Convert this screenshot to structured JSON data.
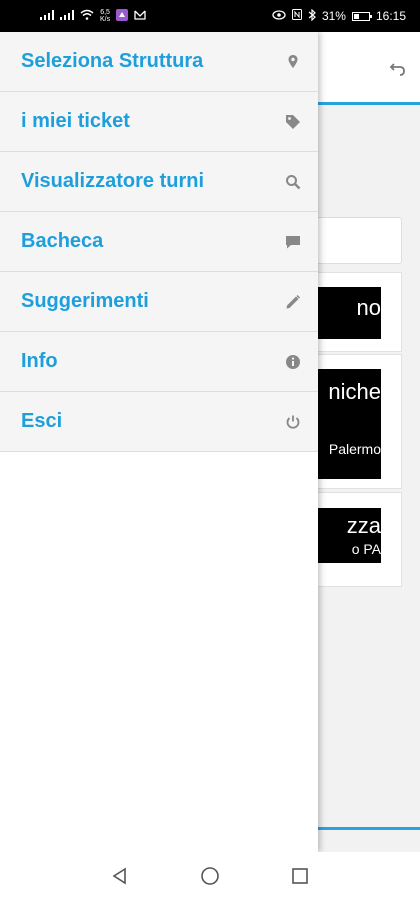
{
  "status_bar": {
    "speed_top": "6,5",
    "speed_bottom": "K/s",
    "battery_percent": "31%",
    "time": "16:15"
  },
  "drawer": {
    "accent_color": "#1e9fdc",
    "items": [
      {
        "label": "Seleziona Struttura",
        "icon": "location-pin-icon"
      },
      {
        "label": "i miei ticket",
        "icon": "tag-icon"
      },
      {
        "label": "Visualizzatore turni",
        "icon": "search-icon"
      },
      {
        "label": "Bacheca",
        "icon": "chat-bubble-icon"
      },
      {
        "label": "Suggerimenti",
        "icon": "pencil-icon"
      },
      {
        "label": "Info",
        "icon": "info-icon"
      },
      {
        "label": "Esci",
        "icon": "power-icon"
      }
    ]
  },
  "background": {
    "card1_text": "no",
    "card2_line1": "niche",
    "card2_line2": "Palermo",
    "card3_line1": "zza",
    "card3_line2": "o PA"
  }
}
